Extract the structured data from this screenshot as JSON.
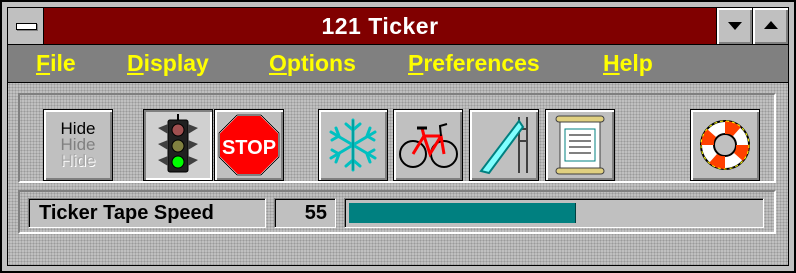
{
  "window": {
    "title": "121 Ticker"
  },
  "menu": [
    {
      "accel": "F",
      "rest": "ile"
    },
    {
      "accel": "D",
      "rest": "isplay"
    },
    {
      "accel": "O",
      "rest": "ptions"
    },
    {
      "accel": "P",
      "rest": "references"
    },
    {
      "accel": "H",
      "rest": "elp"
    }
  ],
  "toolbar": {
    "hide": {
      "line1": "Hide",
      "line2": "Hide",
      "line3": "Hide"
    },
    "stop_label": "STOP",
    "icons": [
      "traffic-light-icon",
      "stop-sign-icon",
      "snowflake-icon",
      "bicycle-icon",
      "slide-icon",
      "scroll-icon",
      "life-preserver-icon"
    ]
  },
  "speed": {
    "label": "Ticker Tape Speed",
    "value": "55",
    "fraction": 0.55,
    "fill_color": "#008080"
  },
  "colors": {
    "title_bar": "#800000",
    "menu_bar": "#808080",
    "menu_text": "#ffff00"
  }
}
